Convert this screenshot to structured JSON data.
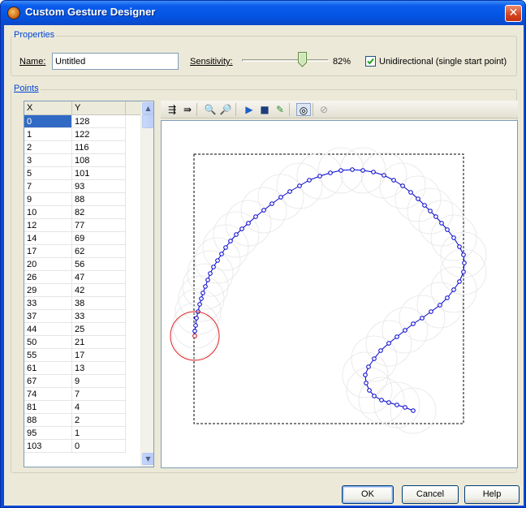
{
  "window": {
    "title": "Custom Gesture Designer",
    "close_glyph": "✕",
    "icon": "gesture-app-icon"
  },
  "properties": {
    "group_label": "Properties",
    "name_label": "Name:",
    "name_value": "Untitled",
    "sensitivity_label": "Sensitivity:",
    "sensitivity_value": "82%",
    "sensitivity_fraction": 0.82,
    "unidirectional_checked": true,
    "unidirectional_label": "Unidirectional (single start point)"
  },
  "points": {
    "group_label": "Points",
    "columns": [
      "X",
      "Y"
    ],
    "rows": [
      [
        0,
        128
      ],
      [
        1,
        122
      ],
      [
        2,
        116
      ],
      [
        3,
        108
      ],
      [
        5,
        101
      ],
      [
        7,
        93
      ],
      [
        9,
        88
      ],
      [
        10,
        82
      ],
      [
        12,
        77
      ],
      [
        14,
        69
      ],
      [
        17,
        62
      ],
      [
        20,
        56
      ],
      [
        26,
        47
      ],
      [
        29,
        42
      ],
      [
        33,
        38
      ],
      [
        37,
        33
      ],
      [
        44,
        25
      ],
      [
        50,
        21
      ],
      [
        55,
        17
      ],
      [
        61,
        13
      ],
      [
        67,
        9
      ],
      [
        74,
        7
      ],
      [
        81,
        4
      ],
      [
        88,
        2
      ],
      [
        95,
        1
      ],
      [
        103,
        0
      ]
    ],
    "selected_row": 0
  },
  "toolbar": {
    "icons": [
      "insert-point-icon",
      "append-point-icon",
      "zoom-in-icon",
      "zoom-out-icon",
      "play-icon",
      "stop-icon",
      "draw-gesture-icon",
      "show-tolerance-icon",
      "clear-icon"
    ],
    "glyphs": [
      "⇶",
      "⇛",
      "🔍",
      "🔎",
      "▶",
      "■",
      "✎",
      "◎",
      "⊘"
    ]
  },
  "buttons": {
    "ok": "OK",
    "cancel": "Cancel",
    "help": "Help"
  },
  "colors": {
    "accent": "#0a4ad8",
    "curve": "#0000cc",
    "start_circle": "#e02020",
    "selection": "#316ac5"
  }
}
